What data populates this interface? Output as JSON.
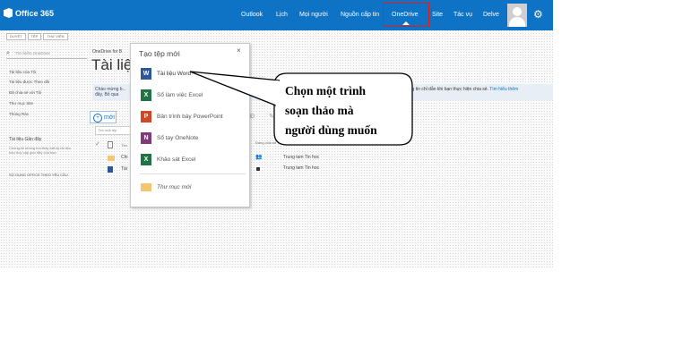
{
  "app": {
    "name": "Office 365"
  },
  "topnav": {
    "items": [
      "Outlook",
      "Lịch",
      "Mọi người",
      "Nguồn cấp tin",
      "OneDrive",
      "Site",
      "Tác vụ",
      "Delve"
    ],
    "highlighted": "OneDrive"
  },
  "ribbon": {
    "tabs": [
      "DUYỆT",
      "TỆP",
      "THƯ VIỆN"
    ]
  },
  "sidebar": {
    "search_placeholder": "Tìm kiếm OneDrive",
    "links": [
      "Tài liệu của Tôi",
      "Tài liệu được Theo dõi",
      "Đã chia sẻ với Tôi",
      "Thư mục Site",
      "Thùng Rác"
    ],
    "recent_heading": "Tài liệu Gần đây",
    "recent_note": "Chúng tôi không tìm thấy bất kỳ tài liệu nào truy cập gần đây của bạn",
    "footer_link": "SỬ DỤNG OFFICE THEO YÊU CẦU"
  },
  "main": {
    "breadcrumb": "OneDrive for B",
    "title": "Tài liệ",
    "banner_left": "Chào mừng b... đây, Bỏ qua",
    "banner_right_text": "ông tin chỉ dẫn khi bạn thực hiện chia sẻ.",
    "banner_link": "Tìm hiểu thêm",
    "new_button": "mới",
    "find_placeholder": "Tìm một tệp",
    "columns": [
      "Tên",
      "Sửa đổi",
      "Sửa đổi bởi",
      "Đang chia sẻ"
    ],
    "rows": [
      {
        "name": "Chi",
        "modified_by": "Trung tam Tin hoc"
      },
      {
        "name": "Tài",
        "modified_by": "Trung tam Tin hoc"
      }
    ],
    "partial_label": "Đ"
  },
  "popup": {
    "title": "Tạo tệp mới",
    "close": "×",
    "items": [
      {
        "label": "Tài liệu Word",
        "icon": "word-icon",
        "color": "#2b579a",
        "letter": "W"
      },
      {
        "label": "Sổ làm việc Excel",
        "icon": "excel-icon",
        "color": "#217346",
        "letter": "X"
      },
      {
        "label": "Bản trình bày PowerPoint",
        "icon": "powerpoint-icon",
        "color": "#d24726",
        "letter": "P"
      },
      {
        "label": "Sổ tay OneNote",
        "icon": "onenote-icon",
        "color": "#80397b",
        "letter": "N"
      },
      {
        "label": "Khảo sát Excel",
        "icon": "excel-survey-icon",
        "color": "#217346",
        "letter": "X"
      }
    ],
    "folder_label": "Thư mục mới"
  },
  "callout": {
    "lines": [
      "Chọn  một trình",
      "soạn thảo mà",
      "người dùng  muốn"
    ]
  },
  "colors": {
    "brand": "#0e72c5",
    "highlight": "#e31b1b"
  }
}
